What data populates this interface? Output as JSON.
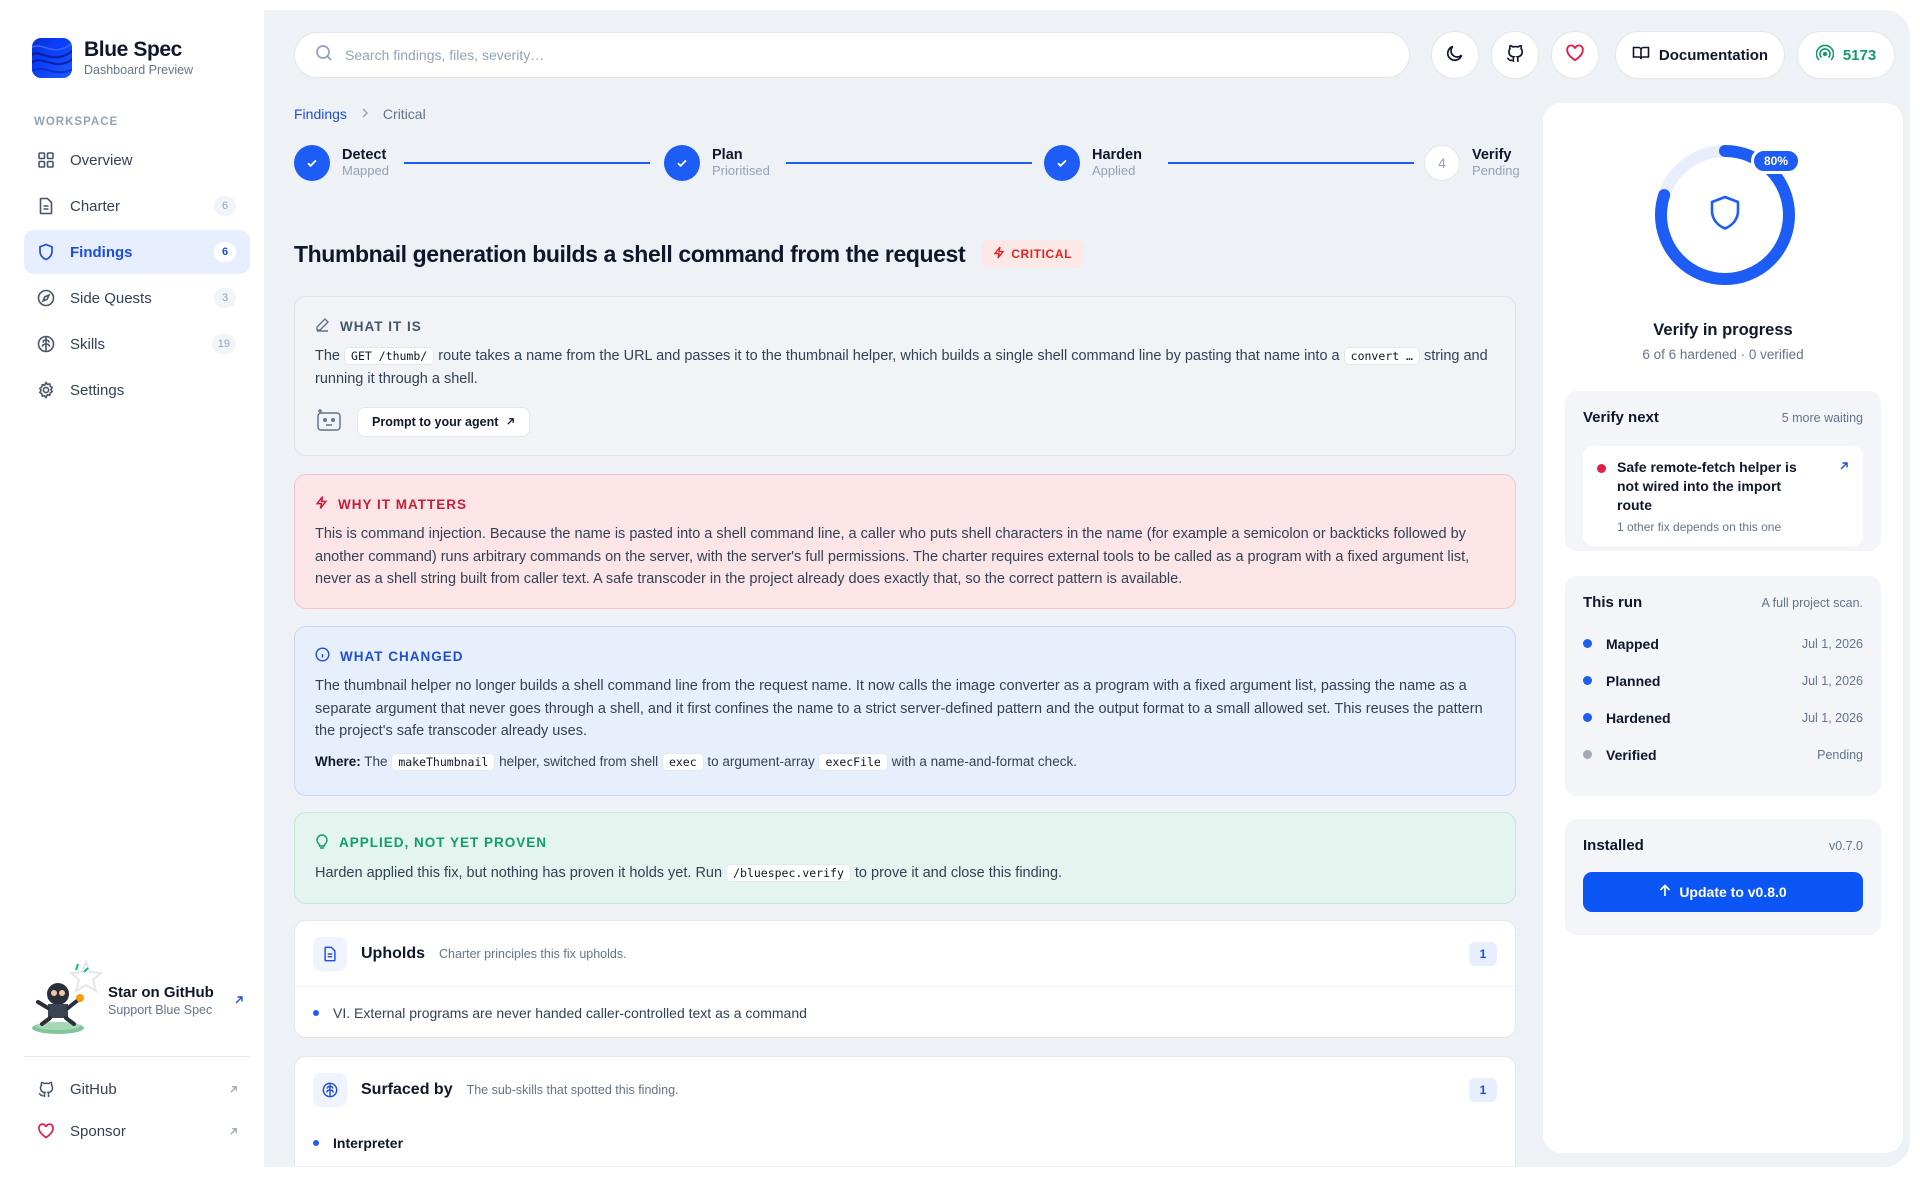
{
  "brand": {
    "name": "Blue Spec",
    "subtitle": "Dashboard Preview"
  },
  "sidebar": {
    "section_label": "WORKSPACE",
    "items": [
      {
        "label": "Overview",
        "icon": "grid-icon",
        "count": ""
      },
      {
        "label": "Charter",
        "icon": "document-icon",
        "count": "6"
      },
      {
        "label": "Findings",
        "icon": "shield-icon",
        "count": "6",
        "active": true
      },
      {
        "label": "Side Quests",
        "icon": "compass-icon",
        "count": "3"
      },
      {
        "label": "Skills",
        "icon": "brain-icon",
        "count": "19"
      },
      {
        "label": "Settings",
        "icon": "gear-icon",
        "count": ""
      }
    ],
    "star_card": {
      "title": "Star on GitHub",
      "subtitle": "Support Blue Spec"
    },
    "links": [
      {
        "label": "GitHub",
        "icon": "github-icon"
      },
      {
        "label": "Sponsor",
        "icon": "heart-icon"
      }
    ]
  },
  "topbar": {
    "search_placeholder": "Search findings, files, severity…",
    "documentation_label": "Documentation",
    "port_label": "5173"
  },
  "breadcrumb": {
    "root": "Findings",
    "current": "Critical"
  },
  "stepper": [
    {
      "name": "Detect",
      "status": "Mapped",
      "done": true
    },
    {
      "name": "Plan",
      "status": "Prioritised",
      "done": true
    },
    {
      "name": "Harden",
      "status": "Applied",
      "done": true
    },
    {
      "name": "Verify",
      "status": "Pending",
      "number": "4",
      "done": false
    }
  ],
  "finding": {
    "title": "Thumbnail generation builds a shell command from the request",
    "severity": "CRITICAL",
    "what_it_is": {
      "heading": "WHAT IT IS",
      "text_1": "The",
      "code_1": "GET /thumb/",
      "text_2": "route takes a name from the URL and passes it to the thumbnail helper, which builds a single shell command line by pasting that name into a",
      "code_2": "convert …",
      "text_3": "string and running it through a shell.",
      "prompt_label": "Prompt to your agent"
    },
    "why_it_matters": {
      "heading": "WHY IT MATTERS",
      "text": "This is command injection. Because the name is pasted into a shell command line, a caller who puts shell characters in the name (for example a semicolon or backticks followed by another command) runs arbitrary commands on the server, with the server's full permissions. The charter requires external tools to be called as a program with a fixed argument list, never as a shell string built from caller text. A safe transcoder in the project already does exactly that, so the correct pattern is available."
    },
    "what_changed": {
      "heading": "WHAT CHANGED",
      "text": "The thumbnail helper no longer builds a shell command line from the request name. It now calls the image converter as a program with a fixed argument list, passing the name as a separate argument that never goes through a shell, and it first confines the name to a strict server-defined pattern and the output format to a small allowed set. This reuses the pattern the project's safe transcoder already uses.",
      "where_label": "Where:",
      "where_1": "The",
      "where_code_1": "makeThumbnail",
      "where_2": "helper, switched from shell",
      "where_code_2": "exec",
      "where_3": "to argument-array",
      "where_code_3": "execFile",
      "where_4": "with a name-and-format check."
    },
    "applied": {
      "heading": "APPLIED, NOT YET PROVEN",
      "text_1": "Harden applied this fix, but nothing has proven it holds yet. Run",
      "code": "/bluespec.verify",
      "text_2": "to prove it and close this finding."
    },
    "upholds": {
      "title": "Upholds",
      "subtitle": "Charter principles this fix upholds.",
      "count": "1",
      "items": [
        "VI. External programs are never handed caller-controlled text as a command"
      ]
    },
    "surfaced_by": {
      "title": "Surfaced by",
      "subtitle": "The sub-skills that spotted this finding.",
      "count": "1",
      "items": [
        "Interpreter"
      ]
    }
  },
  "right_panel": {
    "progress_label": "80%",
    "progress_fraction": 0.8,
    "title": "Verify in progress",
    "subtitle": "6 of 6 hardened · 0 verified",
    "verify_next": {
      "title": "Verify next",
      "meta": "5 more waiting",
      "item_title": "Safe remote-fetch helper is not wired into the import route",
      "item_sub": "1 other fix depends on this one"
    },
    "this_run": {
      "title": "This run",
      "meta": "A full project scan.",
      "rows": [
        {
          "label": "Mapped",
          "date": "Jul 1, 2026",
          "color": "#1d5cf5"
        },
        {
          "label": "Planned",
          "date": "Jul 1, 2026",
          "color": "#1d5cf5"
        },
        {
          "label": "Hardened",
          "date": "Jul 1, 2026",
          "color": "#1d5cf5"
        },
        {
          "label": "Verified",
          "date": "Pending",
          "color": "#a3a9b4"
        }
      ]
    },
    "installed": {
      "title": "Installed",
      "version": "v0.7.0",
      "update_label": "Update to v0.8.0"
    }
  },
  "colors": {
    "accent": "#1d5cf5",
    "critical": "#dc2626",
    "success": "#0f9d6b"
  }
}
